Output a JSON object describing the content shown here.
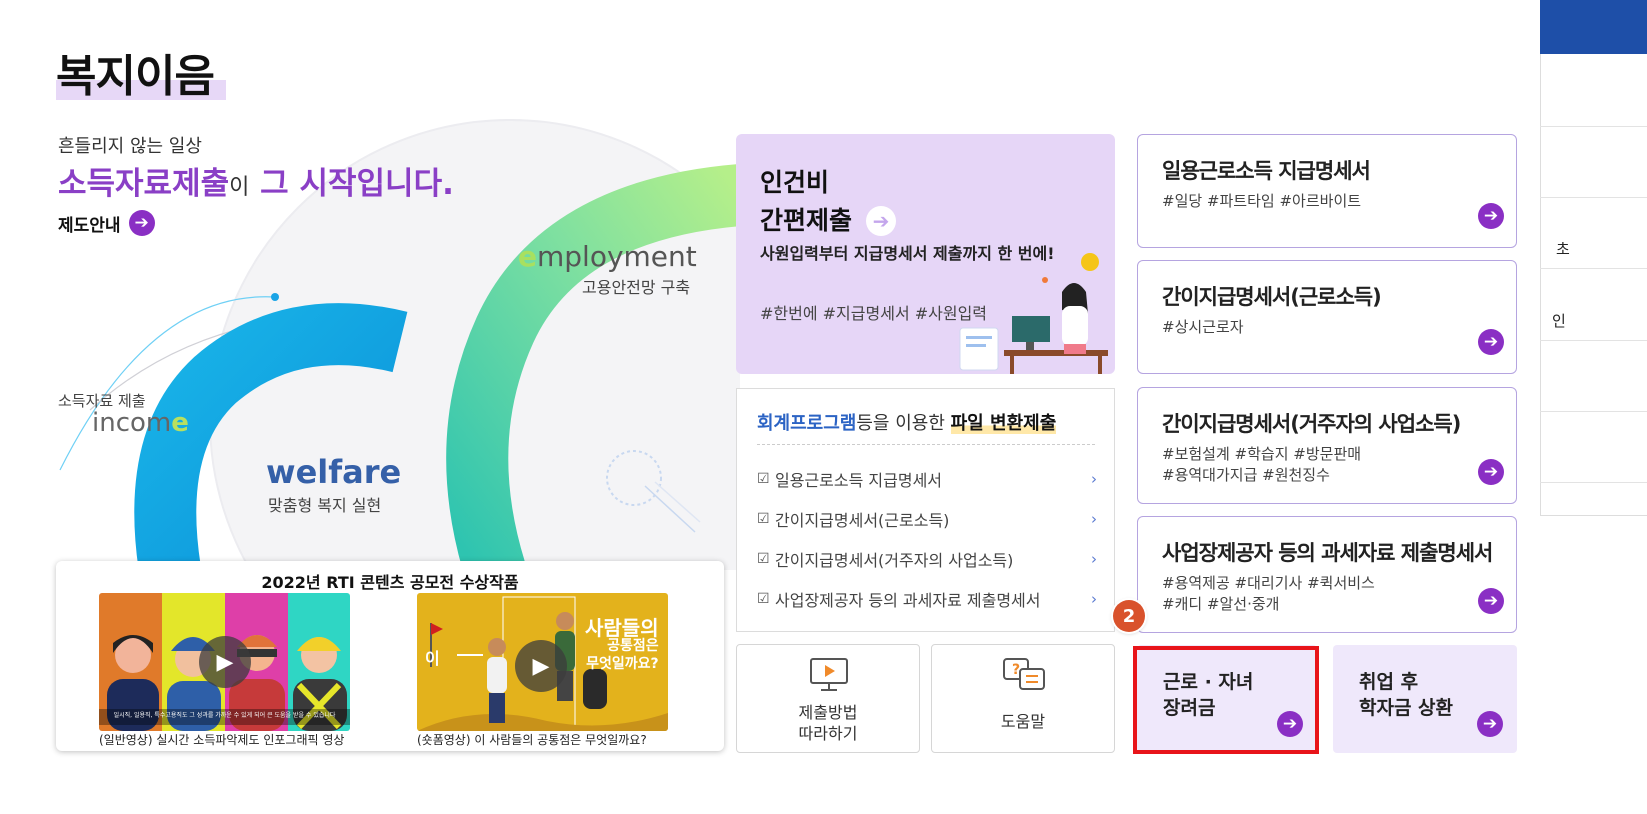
{
  "page": {
    "title": "복지이음"
  },
  "hero": {
    "subtitle": "흔들리지 않는 일상",
    "main_accent": "소득자료제출",
    "main_particle": "이",
    "main_rest": "그 시작입니다.",
    "guide_link": "제도안내",
    "income_caption": "소득자료 제출",
    "income_word_start": "incom",
    "income_word_end": "e",
    "employment_word_start": "e",
    "employment_word_rest": "mployment",
    "employment_caption": "고용안전망 구축",
    "welfare_word": "welfare",
    "welfare_caption": "맞춤형 복지 실현"
  },
  "videos": {
    "title": "2022년 RTI 콘텐츠 공모전 수상작품",
    "items": [
      {
        "caption": "(일반영상) 실시간 소득파악제도 인포그래픽 영상",
        "overlay_text": "일시직, 일용직, 특수고용직도 그 성과를 가까운 수 있게 되어 큰 도움을 받을 수 있습니다"
      },
      {
        "caption": "(숏폼영상) 이 사람들의 공통점은 무엇일까요?",
        "overlay_left": "이",
        "overlay_line1": "사람들의",
        "overlay_line2": "공통점은",
        "overlay_line3": "무엇일까요?"
      }
    ]
  },
  "labor_card": {
    "title_line1": "인건비",
    "title_line2": "간편제출",
    "desc": "사원입력부터 지급명세서 제출까지 한 번에!",
    "tags": "#한번에 #지급명세서 #사원입력"
  },
  "file_card": {
    "head_blue": "회계프로그램",
    "head_mid": "등을 이용한",
    "head_strong": "파일 변환제출",
    "items": [
      "일용근로소득 지급명세서",
      "간이지급명세서(근로소득)",
      "간이지급명세서(거주자의 사업소득)",
      "사업장제공자 등의 과세자료 제출명세서"
    ]
  },
  "small_cards": {
    "method_line1": "제출방법",
    "method_line2": "따라하기",
    "help": "도움말"
  },
  "right_cards": [
    {
      "title": "일용근로소득 지급명세서",
      "tags1": "#일당 #파트타임 #아르바이트",
      "tags2": ""
    },
    {
      "title": "간이지급명세서(근로소득)",
      "tags1": "#상시근로자",
      "tags2": ""
    },
    {
      "title": "간이지급명세서(거주자의 사업소득)",
      "tags1": "#보험설계 #학습지 #방문판매",
      "tags2": "#용역대가지급 #원천징수"
    },
    {
      "title": "사업장제공자 등의 과세자료 제출명세서",
      "tags1": "#용역제공 #대리기사 #퀵서비스",
      "tags2": "#캐디 #알선·중개"
    }
  ],
  "bottom_cards": {
    "earned_line1": "근로 · 자녀",
    "earned_line2": "장려금",
    "loan_line1": "취업 후",
    "loan_line2": "학자금 상환"
  },
  "step_badge": "2",
  "edge": {
    "item_a": "초",
    "item_b": "인"
  },
  "colors": {
    "accent": "#8a2fc4",
    "brand_blue": "#1e4fa8",
    "highlight": "#e8141a",
    "badge": "#d9522c"
  }
}
